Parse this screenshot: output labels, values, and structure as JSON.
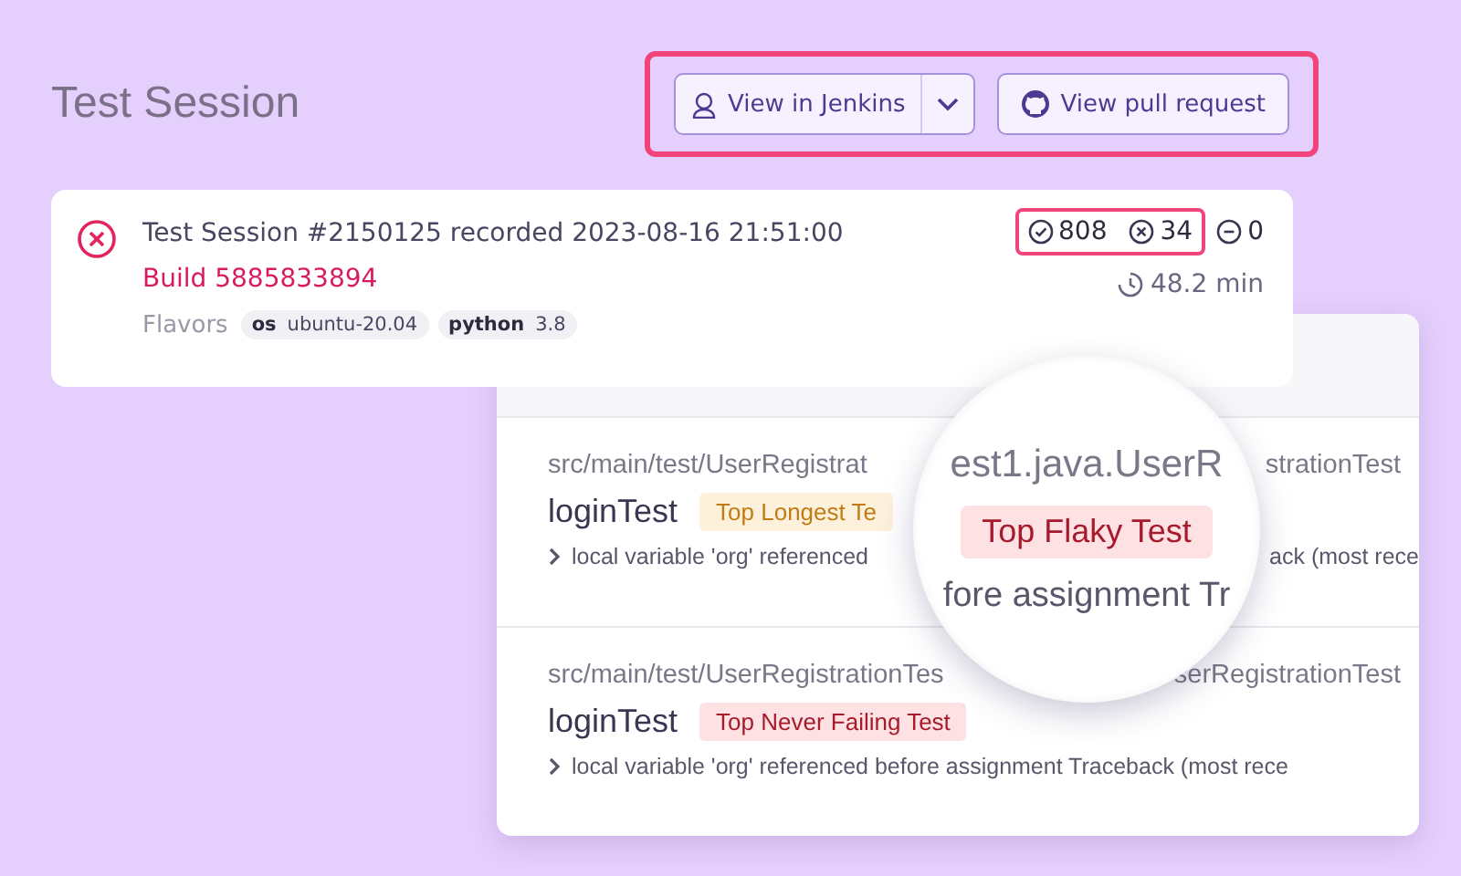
{
  "header": {
    "title": "Test Session",
    "highlighted": true,
    "buttons": [
      {
        "kind": "split",
        "label": "View in Jenkins"
      },
      {
        "kind": "pull",
        "label": "View pull request"
      }
    ]
  },
  "session": {
    "failed": true,
    "title": "Test Session #2150125 recorded 2023-08-16 21:51:00",
    "build": "Build 5885833894",
    "flavors_label": "Flavors",
    "flavors": [
      {
        "key": "os",
        "value": "ubuntu-20.04"
      },
      {
        "key": "python",
        "value": "3.8"
      }
    ],
    "counts": [
      {
        "kind": "passed",
        "value": "808",
        "highlighted": true
      },
      {
        "kind": "failed",
        "value": "34",
        "highlighted": true
      },
      {
        "kind": "skipped",
        "value": "0",
        "highlighted": false
      }
    ],
    "duration": "48.2 min"
  },
  "tests": [
    {
      "path_left": "src/main/test/UserRegistrat",
      "path_right": "strationTest",
      "name": "loginTest",
      "badge": {
        "kind": "warning",
        "label": "Top Longest Te"
      },
      "trace_left": "local variable 'org' referenced",
      "trace_right": "ack (most rece"
    },
    {
      "path_left": "src/main/test/UserRegistrationTes",
      "path_right": "serRegistrationTest",
      "name": "loginTest",
      "badge": {
        "kind": "danger",
        "label": "Top Never Failing Test"
      },
      "trace_left": "local variable 'org' referenced before assignment Traceback (most rece"
    }
  ],
  "magnifier": {
    "path": "est1.java.UserR",
    "badge": {
      "kind": "danger",
      "label": "Top Flaky Test"
    },
    "trace": "fore assignment Tr"
  }
}
